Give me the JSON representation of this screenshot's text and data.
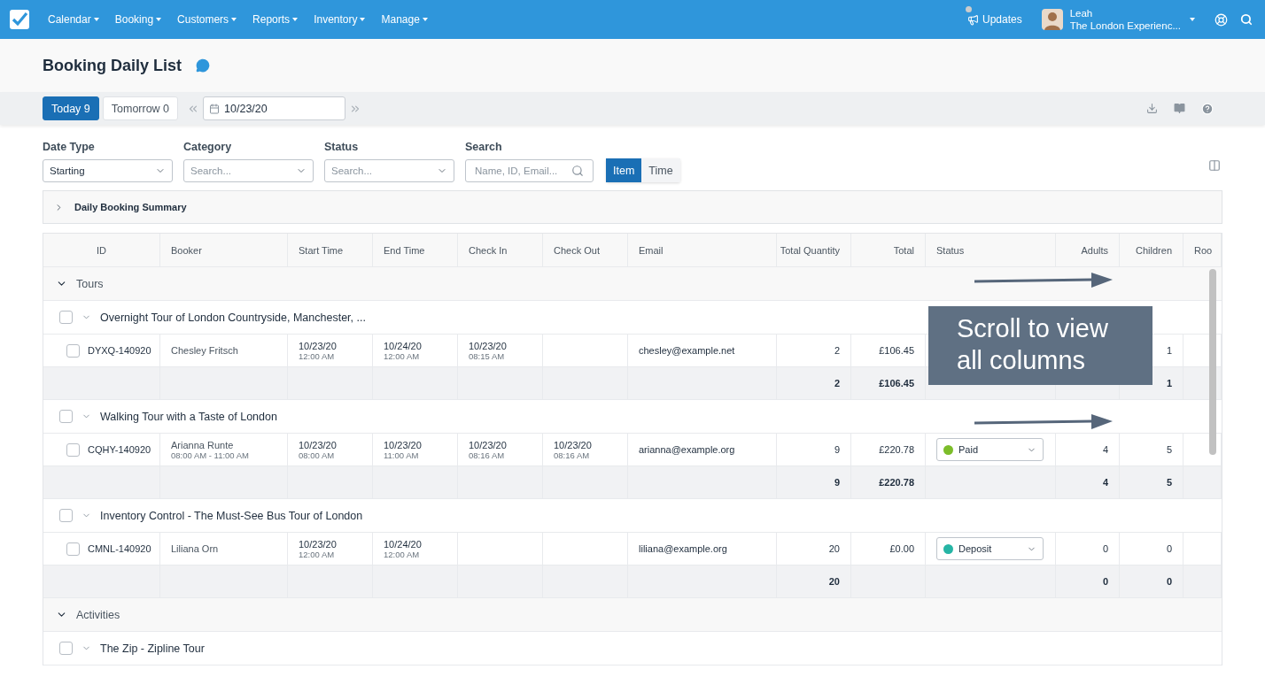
{
  "nav": {
    "menu": [
      {
        "label": "Calendar"
      },
      {
        "label": "Booking"
      },
      {
        "label": "Customers"
      },
      {
        "label": "Reports"
      },
      {
        "label": "Inventory"
      },
      {
        "label": "Manage"
      }
    ],
    "updates": "Updates",
    "user": {
      "name": "Leah",
      "org": "The London Experienc..."
    }
  },
  "page": {
    "title": "Booking Daily List"
  },
  "toolbar": {
    "tabs": [
      {
        "label": "Today 9",
        "selected": true
      },
      {
        "label": "Tomorrow 0",
        "selected": false
      }
    ],
    "date": "10/23/20"
  },
  "filters": [
    {
      "kind": "select",
      "label": "Date Type",
      "value": "Starting"
    },
    {
      "kind": "select",
      "label": "Category",
      "placeholder": "Search..."
    },
    {
      "kind": "select",
      "label": "Status",
      "placeholder": "Search..."
    },
    {
      "kind": "search",
      "label": "Search",
      "placeholder": "Name, ID, Email..."
    }
  ],
  "view_toggle": [
    {
      "label": "Item",
      "selected": true
    },
    {
      "label": "Time",
      "selected": false
    }
  ],
  "summary": {
    "title": "Daily Booking Summary",
    "expanded": false
  },
  "table": {
    "columns": [
      "ID",
      "Booker",
      "Start Time",
      "End Time",
      "Check In",
      "Check Out",
      "Email",
      "Total Quantity",
      "Total",
      "Status",
      "Adults",
      "Children",
      "Roo"
    ],
    "groups": [
      {
        "name": "Tours",
        "expanded": true,
        "products": [
          {
            "name": "Overnight Tour of London Countryside, Manchester, ...",
            "checked": false,
            "expanded": true,
            "bookings": [
              {
                "checked": false,
                "id": "DYXQ-140920",
                "booker": "Chesley Fritsch",
                "start": [
                  "10/23/20",
                  "12:00 AM"
                ],
                "end": [
                  "10/24/20",
                  "12:00 AM"
                ],
                "check_in": [
                  "10/23/20",
                  "08:15 AM"
                ],
                "email": "chesley@example.net",
                "quantity": "2",
                "total": "£106.45",
                "children": "1"
              }
            ],
            "totals": {
              "quantity": "2",
              "total": "£106.45",
              "children": "1"
            }
          },
          {
            "name": "Walking Tour with a Taste of London",
            "checked": false,
            "expanded": true,
            "bookings": [
              {
                "checked": false,
                "id": "CQHY-140920",
                "booker": "Arianna Runte",
                "booker_time": "08:00 AM - 11:00 AM",
                "start": [
                  "10/23/20",
                  "08:00 AM"
                ],
                "end": [
                  "10/23/20",
                  "11:00 AM"
                ],
                "check_in": [
                  "10/23/20",
                  "08:16 AM"
                ],
                "check_out": [
                  "10/23/20",
                  "08:16 AM"
                ],
                "email": "arianna@example.org",
                "quantity": "9",
                "total": "£220.78",
                "status": {
                  "label": "Paid",
                  "color": "#7cbd2a"
                },
                "adults": "4",
                "children": "5"
              }
            ],
            "totals": {
              "quantity": "9",
              "total": "£220.78",
              "adults": "4",
              "children": "5"
            }
          },
          {
            "name": "Inventory Control - The Must-See Bus Tour of London",
            "checked": false,
            "expanded": true,
            "bookings": [
              {
                "checked": false,
                "id": "CMNL-140920",
                "booker": "Liliana Orn",
                "start": [
                  "10/23/20",
                  "12:00 AM"
                ],
                "end": [
                  "10/24/20",
                  "12:00 AM"
                ],
                "email": "liliana@example.org",
                "quantity": "20",
                "total": "£0.00",
                "status": {
                  "label": "Deposit",
                  "color": "#26b5a5"
                },
                "adults": "0",
                "children": "0"
              }
            ],
            "totals": {
              "quantity": "20",
              "adults": "0",
              "children": "0"
            }
          }
        ]
      },
      {
        "name": "Activities",
        "expanded": true,
        "products": [
          {
            "name": "The Zip - Zipline Tour",
            "checked": false,
            "expanded": true
          }
        ]
      }
    ]
  },
  "hint": {
    "text": "Scroll to view all columns"
  }
}
